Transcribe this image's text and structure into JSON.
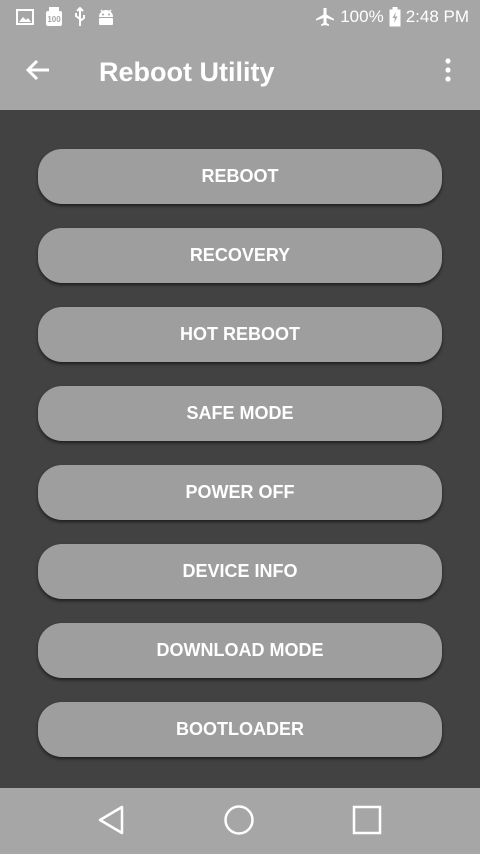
{
  "status_bar": {
    "battery_percent": "100%",
    "time": "2:48 PM",
    "icons": [
      "image-icon",
      "storage-100-icon",
      "usb-icon",
      "android-debug-icon",
      "airplane-mode-icon",
      "battery-charging-icon"
    ]
  },
  "app_bar": {
    "title": "Reboot Utility",
    "icons": [
      "arrow-back-icon",
      "more-vert-icon"
    ]
  },
  "actions": [
    {
      "label": "REBOOT"
    },
    {
      "label": "RECOVERY"
    },
    {
      "label": "HOT REBOOT"
    },
    {
      "label": "SAFE MODE"
    },
    {
      "label": "POWER OFF"
    },
    {
      "label": "DEVICE INFO"
    },
    {
      "label": "DOWNLOAD MODE"
    },
    {
      "label": "BOOTLOADER"
    }
  ],
  "nav_bar": {
    "icons": [
      "back-triangle-icon",
      "home-circle-icon",
      "recents-square-icon"
    ]
  },
  "colors": {
    "bar_background": "#a6a6a6",
    "content_background": "#424242",
    "button_background": "#9e9e9e",
    "text": "#ffffff"
  }
}
